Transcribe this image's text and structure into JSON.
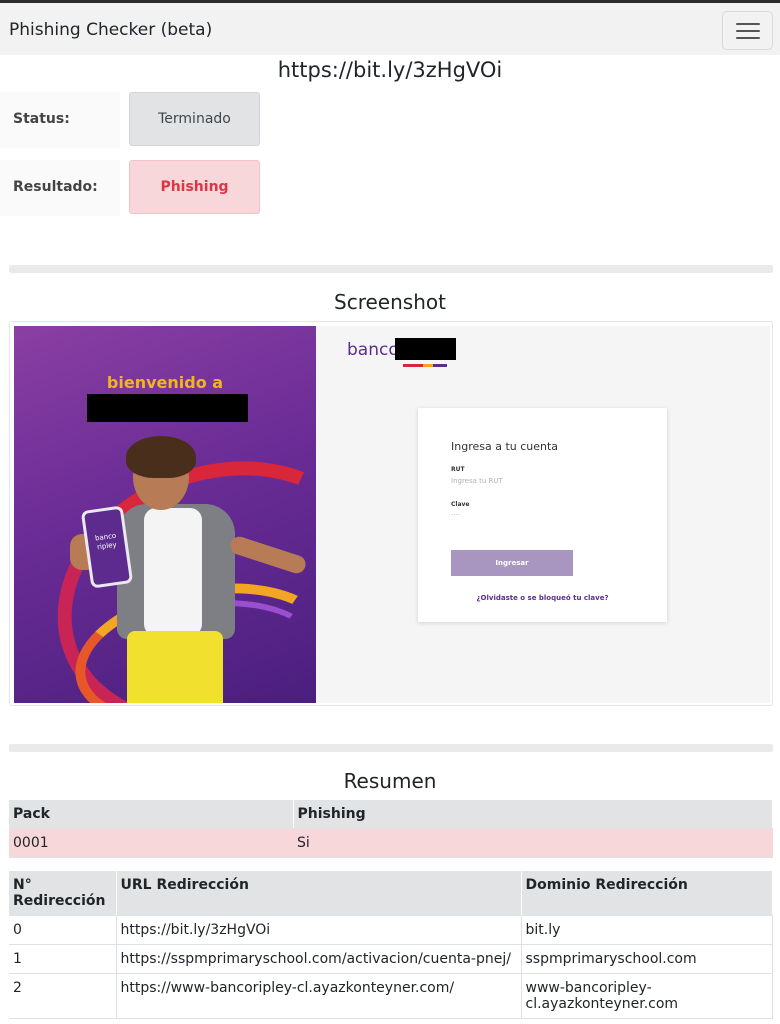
{
  "navbar": {
    "brand": "Phishing Checker (beta)",
    "toggle_icon": "hamburger-menu-icon"
  },
  "analysis": {
    "url": "https://bit.ly/3zHgVOi",
    "status_label": "Status:",
    "status_value": "Terminado",
    "result_label": "Resultado:",
    "result_value": "Phishing"
  },
  "screenshot": {
    "title": "Screenshot",
    "welcome_text": "bienvenido a",
    "phone_text": "banco ripley",
    "logo_text": "banco",
    "login_title": "Ingresa a tu cuenta",
    "rut_label": "RUT",
    "rut_placeholder": "Ingresa tu RUT",
    "clave_label": "Clave",
    "clave_placeholder": "····",
    "login_button": "Ingresar",
    "forgot_link": "¿Olvidaste o se bloqueó tu clave?",
    "colors": {
      "purple": "#6a2c96",
      "yellow": "#f2b51e",
      "button": "#a896c1"
    }
  },
  "summary": {
    "title": "Resumen",
    "pack_headers": [
      "Pack",
      "Phishing"
    ],
    "pack_rows": [
      [
        "0001",
        "Si"
      ]
    ],
    "redirect_headers": [
      "N° Redirección",
      "URL Redirección",
      "Dominio Redirección"
    ],
    "redirect_rows": [
      [
        "0",
        "https://bit.ly/3zHgVOi",
        "bit.ly"
      ],
      [
        "1",
        "https://sspmprimaryschool.com/activacion/cuenta-pnej/",
        "sspmprimaryschool.com"
      ],
      [
        "2",
        "https://www-bancoripley-cl.ayazkonteyner.com/",
        "www-bancoripley-cl.ayazkonteyner.com"
      ]
    ]
  },
  "colors": {
    "danger_bg": "#f8d7da",
    "danger_text": "#dc3545",
    "secondary_bg": "#e2e3e5"
  }
}
